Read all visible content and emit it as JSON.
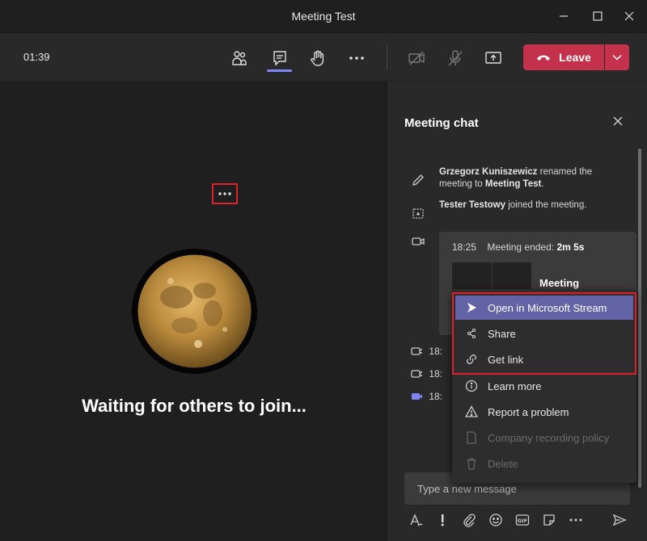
{
  "window": {
    "title": "Meeting Test"
  },
  "toolbar": {
    "timer": "01:39",
    "leave_label": "Leave"
  },
  "stage": {
    "waiting_text": "Waiting for others to join..."
  },
  "chat": {
    "title": "Meeting chat",
    "events": [
      {
        "actor": "Grzegorz Kuniszewicz",
        "text": " renamed the meeting to ",
        "target": "Meeting Test",
        "suffix": "."
      },
      {
        "actor": "Tester Testowy",
        "text": " joined the meeting.",
        "target": "",
        "suffix": ""
      }
    ],
    "card": {
      "time": "18:25",
      "ended_label": "Meeting ended: ",
      "duration": "2m 5s",
      "title": "Meeting"
    },
    "later_times": [
      "18:",
      "18:",
      "18:"
    ],
    "composer_placeholder": "Type a new message"
  },
  "menu": {
    "items": [
      {
        "label": "Open in Microsoft Stream",
        "state": "active"
      },
      {
        "label": "Share",
        "state": "normal"
      },
      {
        "label": "Get link",
        "state": "normal"
      },
      {
        "label": "Learn more",
        "state": "normal"
      },
      {
        "label": "Report a problem",
        "state": "normal"
      },
      {
        "label": "Company recording policy",
        "state": "disabled"
      },
      {
        "label": "Delete",
        "state": "disabled"
      }
    ]
  },
  "colors": {
    "accent": "#6264a7",
    "leave": "#c4314b",
    "highlight_border": "#e0202a"
  }
}
